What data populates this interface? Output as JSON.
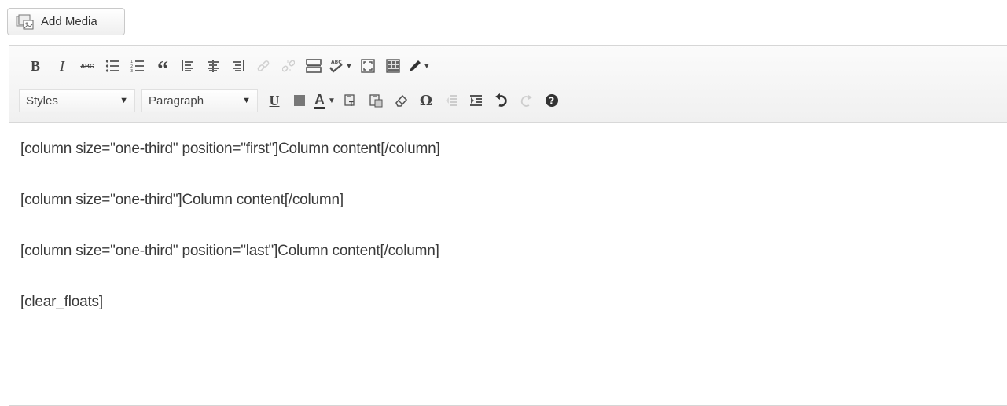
{
  "media": {
    "add_media_label": "Add Media"
  },
  "toolbar": {
    "row1": {
      "bold": "B",
      "italic": "I",
      "strikethrough": "ABC",
      "blockquote": "“"
    },
    "row2": {
      "styles": "Styles",
      "format": "Paragraph",
      "underline": "U",
      "text_color": "A",
      "special_char": "Ω"
    }
  },
  "content": {
    "paragraphs": [
      "[column size=\"one-third\" position=\"first\"]Column content[/column]",
      "[column size=\"one-third\"]Column content[/column]",
      "[column size=\"one-third\" position=\"last\"]Column content[/column]",
      "[clear_floats]"
    ]
  }
}
